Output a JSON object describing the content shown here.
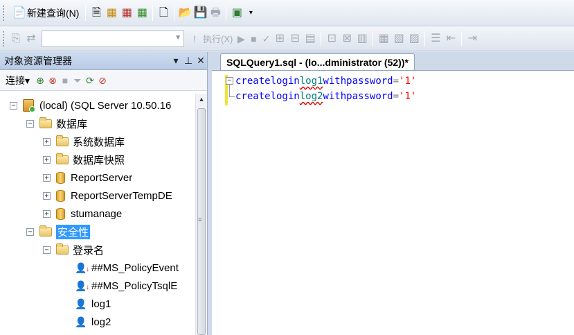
{
  "toolbar1": {
    "new_query_label": "新建查询(N)"
  },
  "toolbar2": {
    "database_combo_value": "",
    "execute_label": "执行(X)"
  },
  "object_explorer": {
    "title": "对象资源管理器",
    "pin_glyph": "▾",
    "autohide_glyph": "ᚑ",
    "close_glyph": "✕",
    "connect_label": "连接",
    "tree": {
      "server": "(local) (SQL Server 10.50.16",
      "databases": "数据库",
      "system_databases": "系统数据库",
      "database_snapshots": "数据库快照",
      "db_reportserver": "ReportServer",
      "db_reportservertempdb": "ReportServerTempDE",
      "db_stumanage": "stumanage",
      "security": "安全性",
      "logins": "登录名",
      "login_policyevent": "##MS_PolicyEvent",
      "login_policytsql": "##MS_PolicyTsqlE",
      "login_log1": "log1",
      "login_log2": "log2"
    }
  },
  "editor": {
    "tab_title": "SQLQuery1.sql - (lo...dministrator (52))*",
    "lines": [
      {
        "kw1": "create",
        "kw2": "login",
        "name": "log1",
        "kw3": "with",
        "kw4": "password",
        "op": "=",
        "str": "'1'"
      },
      {
        "kw1": "create",
        "kw2": "login",
        "name": "log2",
        "kw3": "with",
        "kw4": "password",
        "op": "=",
        "str": "'1'"
      }
    ]
  },
  "icons": {
    "new_query": "new-query-icon",
    "save": "save-icon",
    "open": "open-folder-icon",
    "execute": "execute-icon",
    "debug": "debug-play-icon"
  }
}
